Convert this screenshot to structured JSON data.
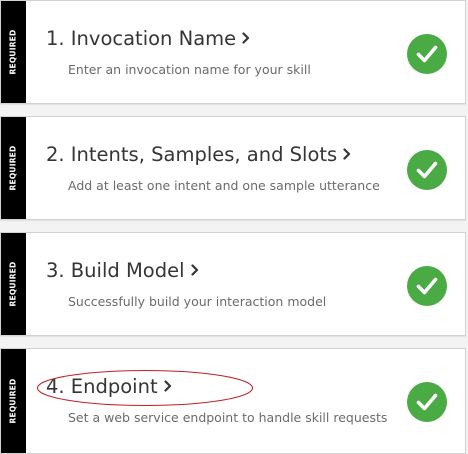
{
  "steps": [
    {
      "required_label": "REQUIRED",
      "title": "1. Invocation Name",
      "description": "Enter an invocation name for your skill",
      "status": "complete"
    },
    {
      "required_label": "REQUIRED",
      "title": "2. Intents, Samples, and Slots",
      "description": "Add at least one intent and one sample utterance",
      "status": "complete"
    },
    {
      "required_label": "REQUIRED",
      "title": "3. Build Model",
      "description": "Successfully build your interaction model",
      "status": "complete"
    },
    {
      "required_label": "REQUIRED",
      "title": "4. Endpoint",
      "description": "Set a web service endpoint to handle skill requests",
      "status": "complete"
    }
  ],
  "icons": {
    "chevron": "chevron-right-icon",
    "status": "check-circle-icon",
    "annotation": "red-ellipse-annotation"
  },
  "colors": {
    "required_bar": "#000000",
    "check": "#4aab45",
    "annotation": "#c0202a",
    "title": "#353535",
    "description": "#6b6b6b"
  }
}
